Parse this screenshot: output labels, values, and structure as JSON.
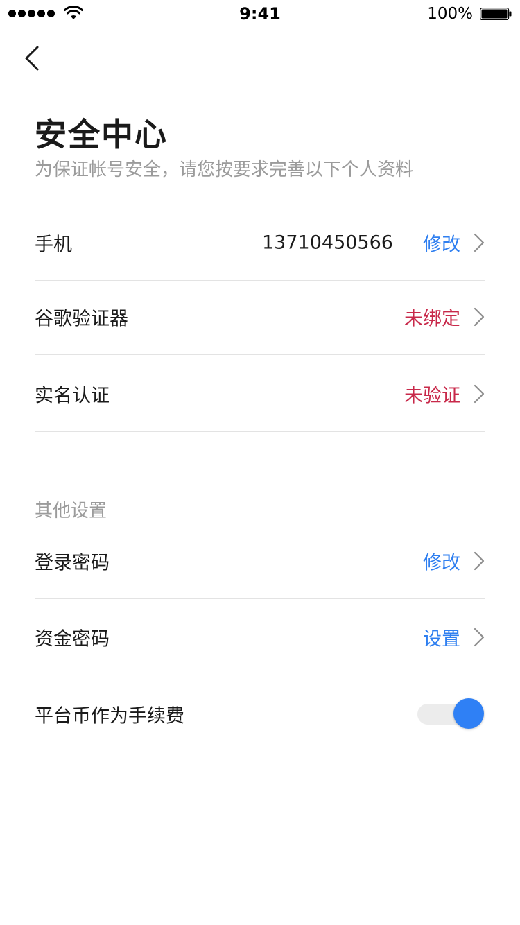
{
  "status_bar": {
    "time": "9:41",
    "battery": "100%"
  },
  "header": {
    "title": "安全中心",
    "subtitle": "为保证帐号安全，请您按要求完善以下个人资料"
  },
  "security_items": [
    {
      "label": "手机",
      "value": "13710450566",
      "action": "修改"
    },
    {
      "label": "谷歌验证器",
      "action": "未绑定"
    },
    {
      "label": "实名认证",
      "action": "未验证"
    }
  ],
  "other_settings": {
    "section_title": "其他设置",
    "items": [
      {
        "label": "登录密码",
        "action": "修改"
      },
      {
        "label": "资金密码",
        "action": "设置"
      },
      {
        "label": "平台币作为手续费",
        "toggle_on": true
      }
    ]
  },
  "colors": {
    "accent_blue": "#2f7ff0",
    "warning_red": "#c8294a",
    "toggle_on": "#2f80f5"
  },
  "icons": {
    "back": "chevron-left-icon",
    "row_arrow": "chevron-right-icon",
    "wifi": "wifi-icon",
    "battery": "battery-icon",
    "signal": "signal-dots-icon"
  }
}
